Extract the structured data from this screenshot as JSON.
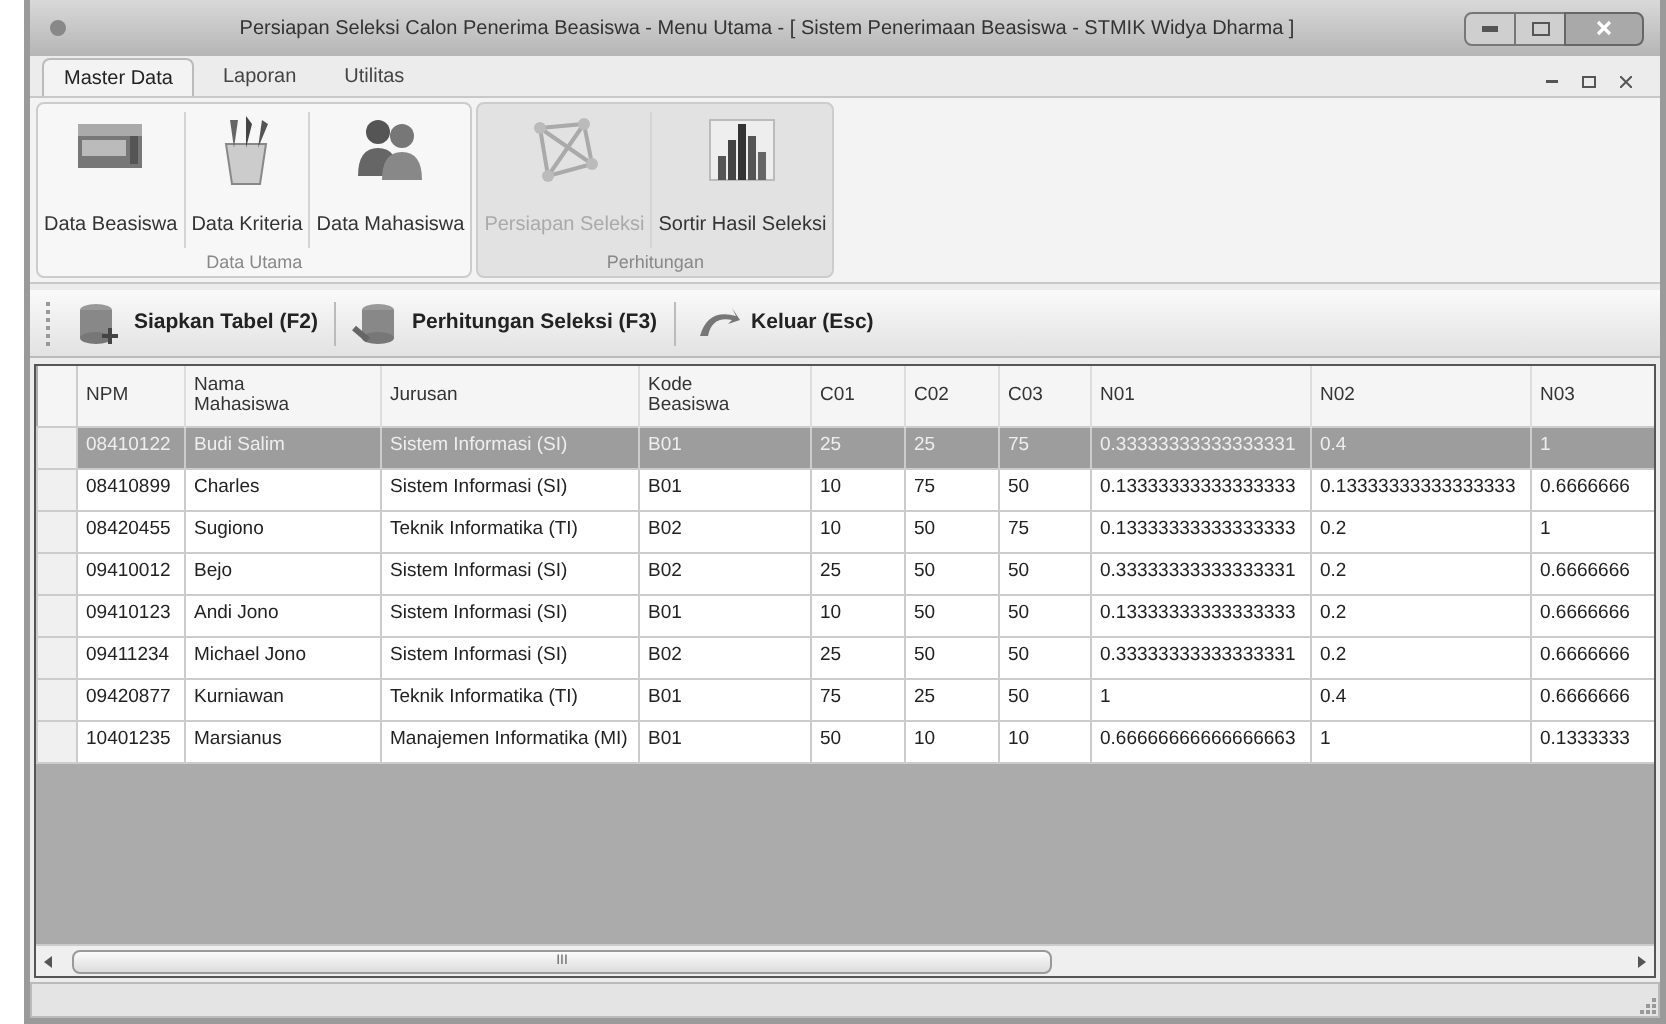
{
  "window": {
    "title": "Persiapan Seleksi Calon Penerima Beasiswa - Menu Utama - [ Sistem Penerimaan Beasiswa - STMIK Widya Dharma ]"
  },
  "ribbon_tabs": [
    {
      "label": "Master Data",
      "selected": true
    },
    {
      "label": "Laporan",
      "selected": false
    },
    {
      "label": "Utilitas",
      "selected": false
    }
  ],
  "ribbon_groups": [
    {
      "title": "Data Utama",
      "disabled": false,
      "buttons": [
        {
          "label": "Data Beasiswa",
          "kind": "box",
          "disabled": false
        },
        {
          "label": "Data Kriteria",
          "kind": "pencils",
          "disabled": false
        },
        {
          "label": "Data Mahasiswa",
          "kind": "people",
          "disabled": false
        }
      ]
    },
    {
      "title": "Perhitungan",
      "disabled": true,
      "buttons": [
        {
          "label": "Persiapan Seleksi",
          "kind": "network",
          "disabled": true
        },
        {
          "label": "Sortir Hasil Seleksi",
          "kind": "chart",
          "disabled": false
        }
      ]
    }
  ],
  "toolbar": [
    {
      "label": "Siapkan Tabel (F2)",
      "kind": "dbadd"
    },
    {
      "label": "Perhitungan Seleksi (F3)",
      "kind": "db"
    },
    {
      "label": "Keluar (Esc)",
      "kind": "undo"
    }
  ],
  "table": {
    "columns": [
      "NPM",
      "Nama Mahasiswa",
      "Jurusan",
      "Kode Beasiswa",
      "C01",
      "C02",
      "C03",
      "N01",
      "N02",
      "N03"
    ],
    "rows": [
      {
        "selected": true,
        "cells": [
          "08410122",
          "Budi Salim",
          "Sistem Informasi (SI)",
          "B01",
          "25",
          "25",
          "75",
          "0.33333333333333331",
          "0.4",
          "1"
        ]
      },
      {
        "selected": false,
        "cells": [
          "08410899",
          "Charles",
          "Sistem Informasi (SI)",
          "B01",
          "10",
          "75",
          "50",
          "0.13333333333333333",
          "0.13333333333333333",
          "0.6666666"
        ]
      },
      {
        "selected": false,
        "cells": [
          "08420455",
          "Sugiono",
          "Teknik Informatika (TI)",
          "B02",
          "10",
          "50",
          "75",
          "0.13333333333333333",
          "0.2",
          "1"
        ]
      },
      {
        "selected": false,
        "cells": [
          "09410012",
          "Bejo",
          "Sistem Informasi (SI)",
          "B02",
          "25",
          "50",
          "50",
          "0.33333333333333331",
          "0.2",
          "0.6666666"
        ]
      },
      {
        "selected": false,
        "cells": [
          "09410123",
          "Andi Jono",
          "Sistem Informasi (SI)",
          "B01",
          "10",
          "50",
          "50",
          "0.13333333333333333",
          "0.2",
          "0.6666666"
        ]
      },
      {
        "selected": false,
        "cells": [
          "09411234",
          "Michael Jono",
          "Sistem Informasi (SI)",
          "B02",
          "25",
          "50",
          "50",
          "0.33333333333333331",
          "0.2",
          "0.6666666"
        ]
      },
      {
        "selected": false,
        "cells": [
          "09420877",
          "Kurniawan",
          "Teknik Informatika (TI)",
          "B01",
          "75",
          "25",
          "50",
          "1",
          "0.4",
          "0.6666666"
        ]
      },
      {
        "selected": false,
        "cells": [
          "10401235",
          "Marsianus",
          "Manajemen Informatika (MI)",
          "B01",
          "50",
          "10",
          "10",
          "0.66666666666666663",
          "1",
          "0.1333333"
        ]
      }
    ]
  },
  "scrollbar": {
    "grip": "III"
  }
}
